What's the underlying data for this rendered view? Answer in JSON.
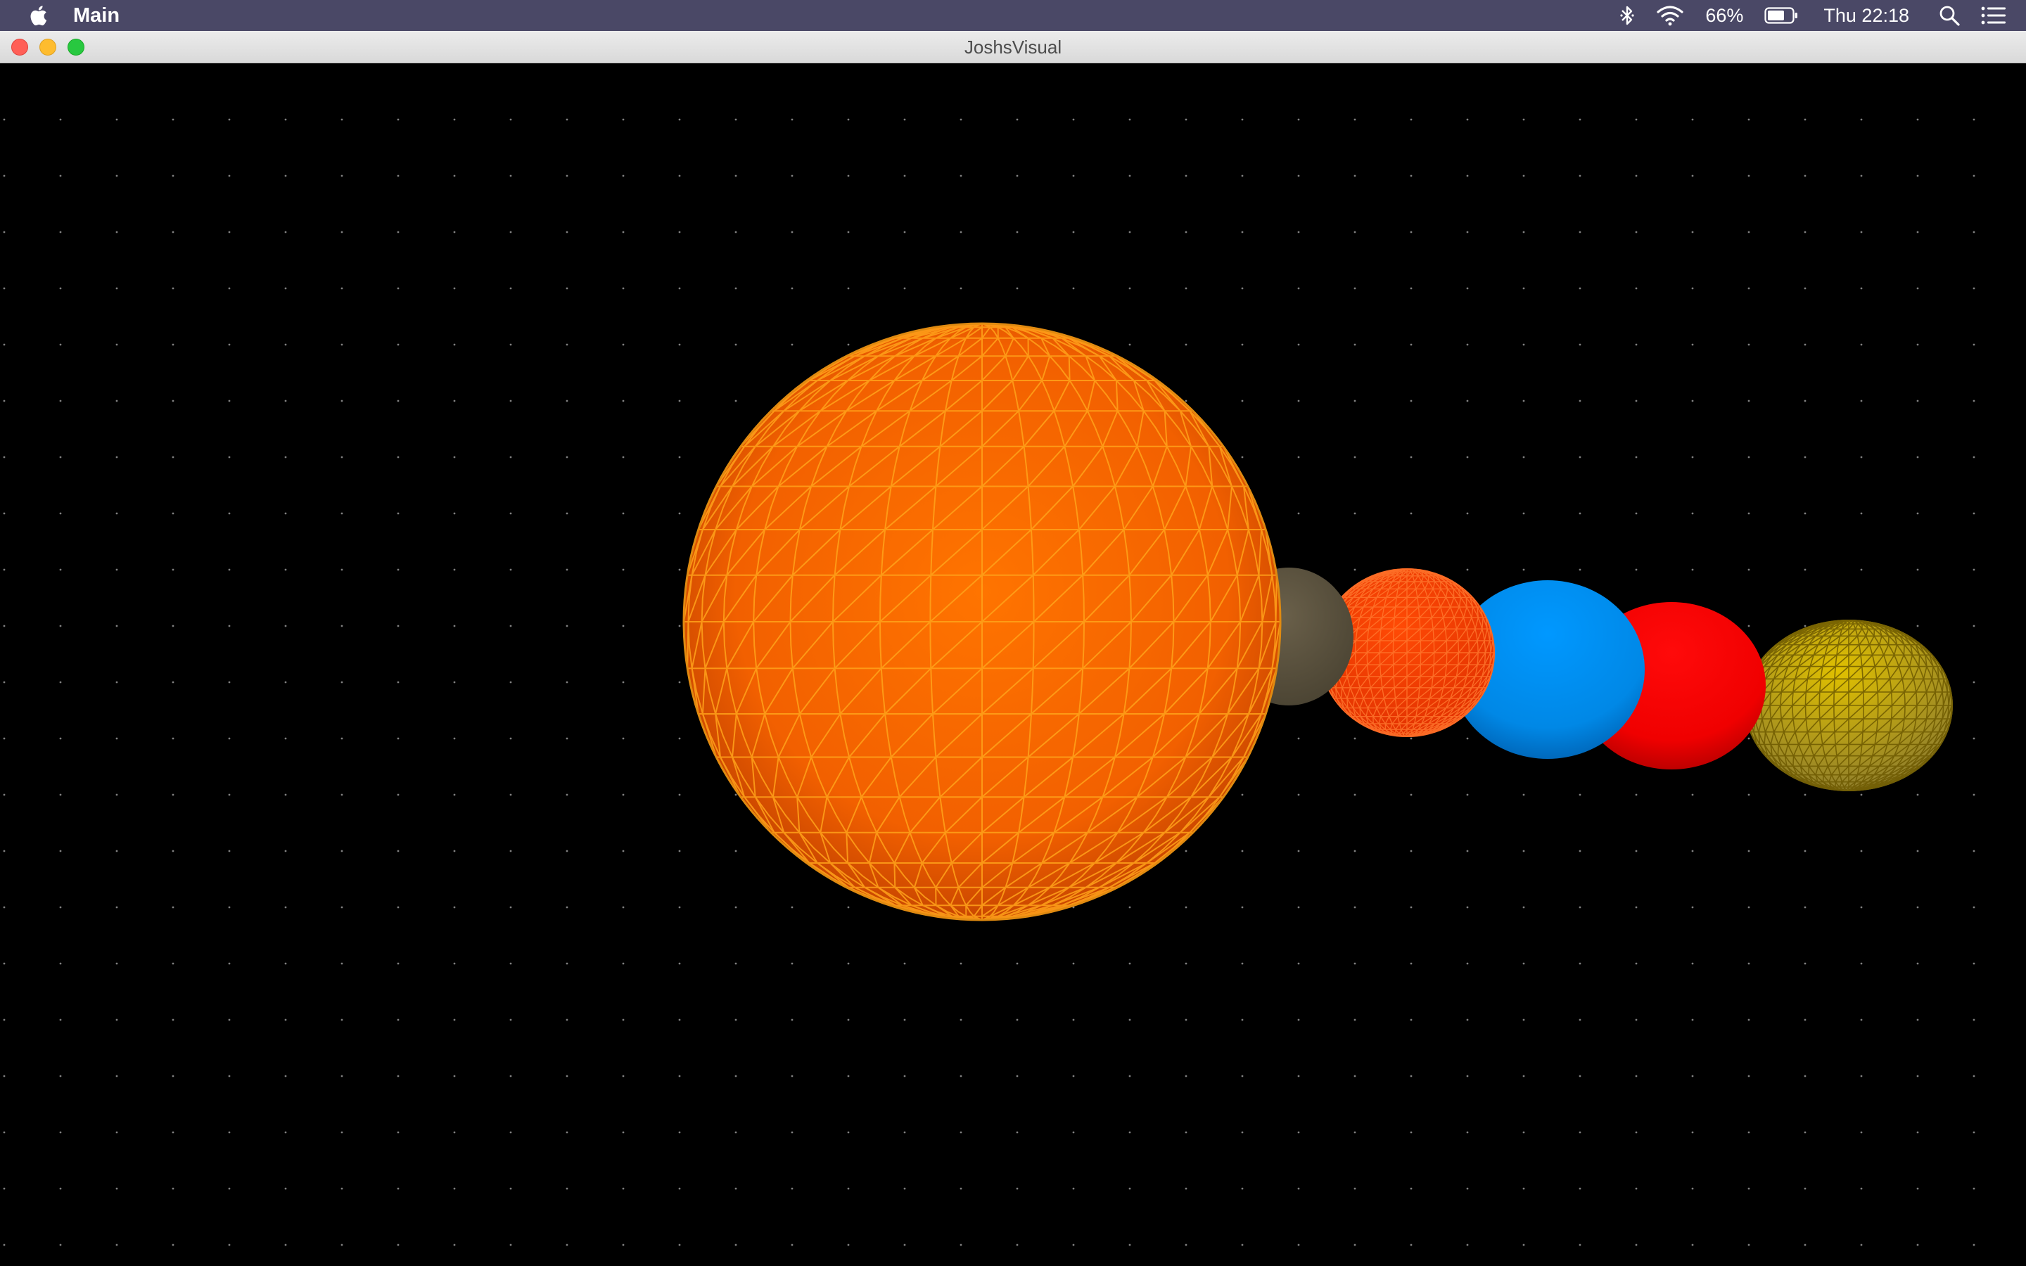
{
  "menubar": {
    "apple_icon": "apple-logo-icon",
    "app_name": "Main",
    "battery_percent": "66%",
    "clock": "Thu 22:18",
    "icons": [
      "bluetooth-icon",
      "wifi-icon",
      "battery-icon",
      "spotlight-search-icon",
      "notification-center-icon"
    ]
  },
  "window": {
    "title": "JoshsVisual"
  },
  "scene": {
    "background_color": "#000000",
    "star_color": "#808080",
    "bodies": [
      {
        "name": "sun",
        "color": "#ff6a00",
        "wire_color": "#ffa020",
        "style": "wireframe"
      },
      {
        "name": "grey-planet",
        "color": "#5e5540",
        "style": "solid"
      },
      {
        "name": "orange-planet",
        "color": "#ff3d00",
        "wire_color": "#ff8a40",
        "style": "wireframe"
      },
      {
        "name": "blue-planet",
        "color": "#0091f0",
        "style": "solid"
      },
      {
        "name": "red-planet",
        "color": "#ff0000",
        "style": "solid"
      },
      {
        "name": "yellow-planet",
        "color": "#d4b000",
        "wire_color": "#8a7000",
        "style": "wireframe"
      }
    ]
  }
}
